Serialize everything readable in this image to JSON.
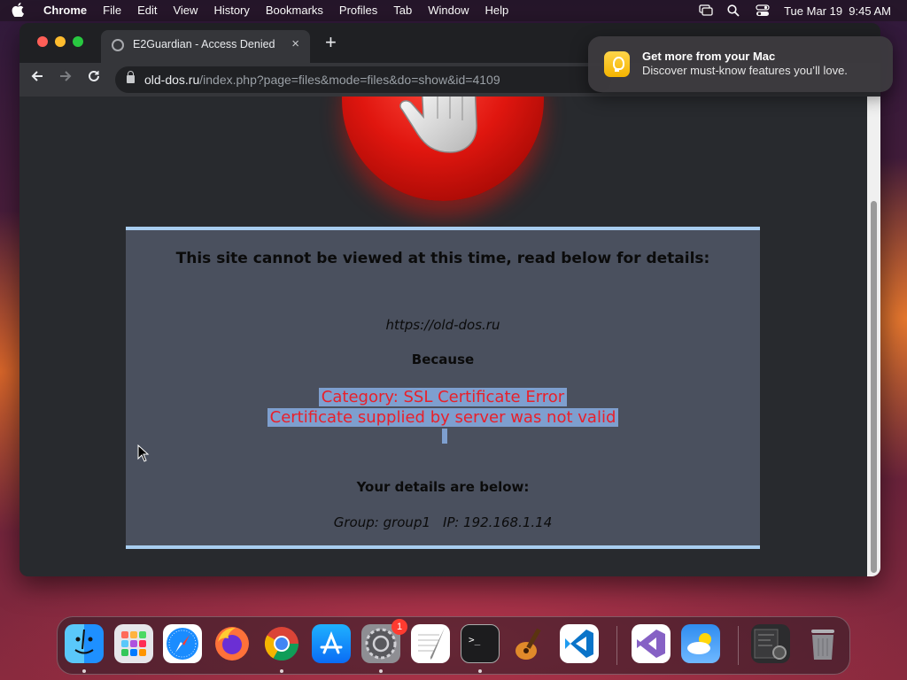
{
  "menubar": {
    "app": "Chrome",
    "menus": [
      "File",
      "Edit",
      "View",
      "History",
      "Bookmarks",
      "Profiles",
      "Tab",
      "Window",
      "Help"
    ],
    "clock": "Tue Mar 19  9:45 AM"
  },
  "browser": {
    "tab_title": "E2Guardian - Access Denied",
    "url_host": "old-dos.ru",
    "url_path": "/index.php?page=files&mode=files&do=show&id=4109"
  },
  "page": {
    "heading": "This site cannot be viewed at this time, read below for details:",
    "blocked_url": "https://old-dos.ru",
    "because": "Because",
    "category": "Category: SSL Certificate Error",
    "reason": "Certificate supplied by server was not valid",
    "details_title": "Your details are below:",
    "group": "Group: group1",
    "ip": "IP: 192.168.1.14"
  },
  "notification": {
    "title": "Get more from your Mac",
    "body": "Discover must-know features you’ll love."
  },
  "dock": {
    "apps": [
      "finder",
      "launchpad",
      "safari",
      "firefox",
      "chrome",
      "app-store",
      "system-settings",
      "textedit",
      "terminal",
      "garageband",
      "vscode",
      "visual-studio",
      "weather",
      "downloads",
      "trash"
    ],
    "system_settings_badge": "1"
  },
  "colors": {
    "panel_bg": "#4a505e",
    "panel_border": "#a8cdf0",
    "error_text": "#e8202a",
    "selection": "#7e9fcf",
    "stop_red": "#e0160f"
  }
}
